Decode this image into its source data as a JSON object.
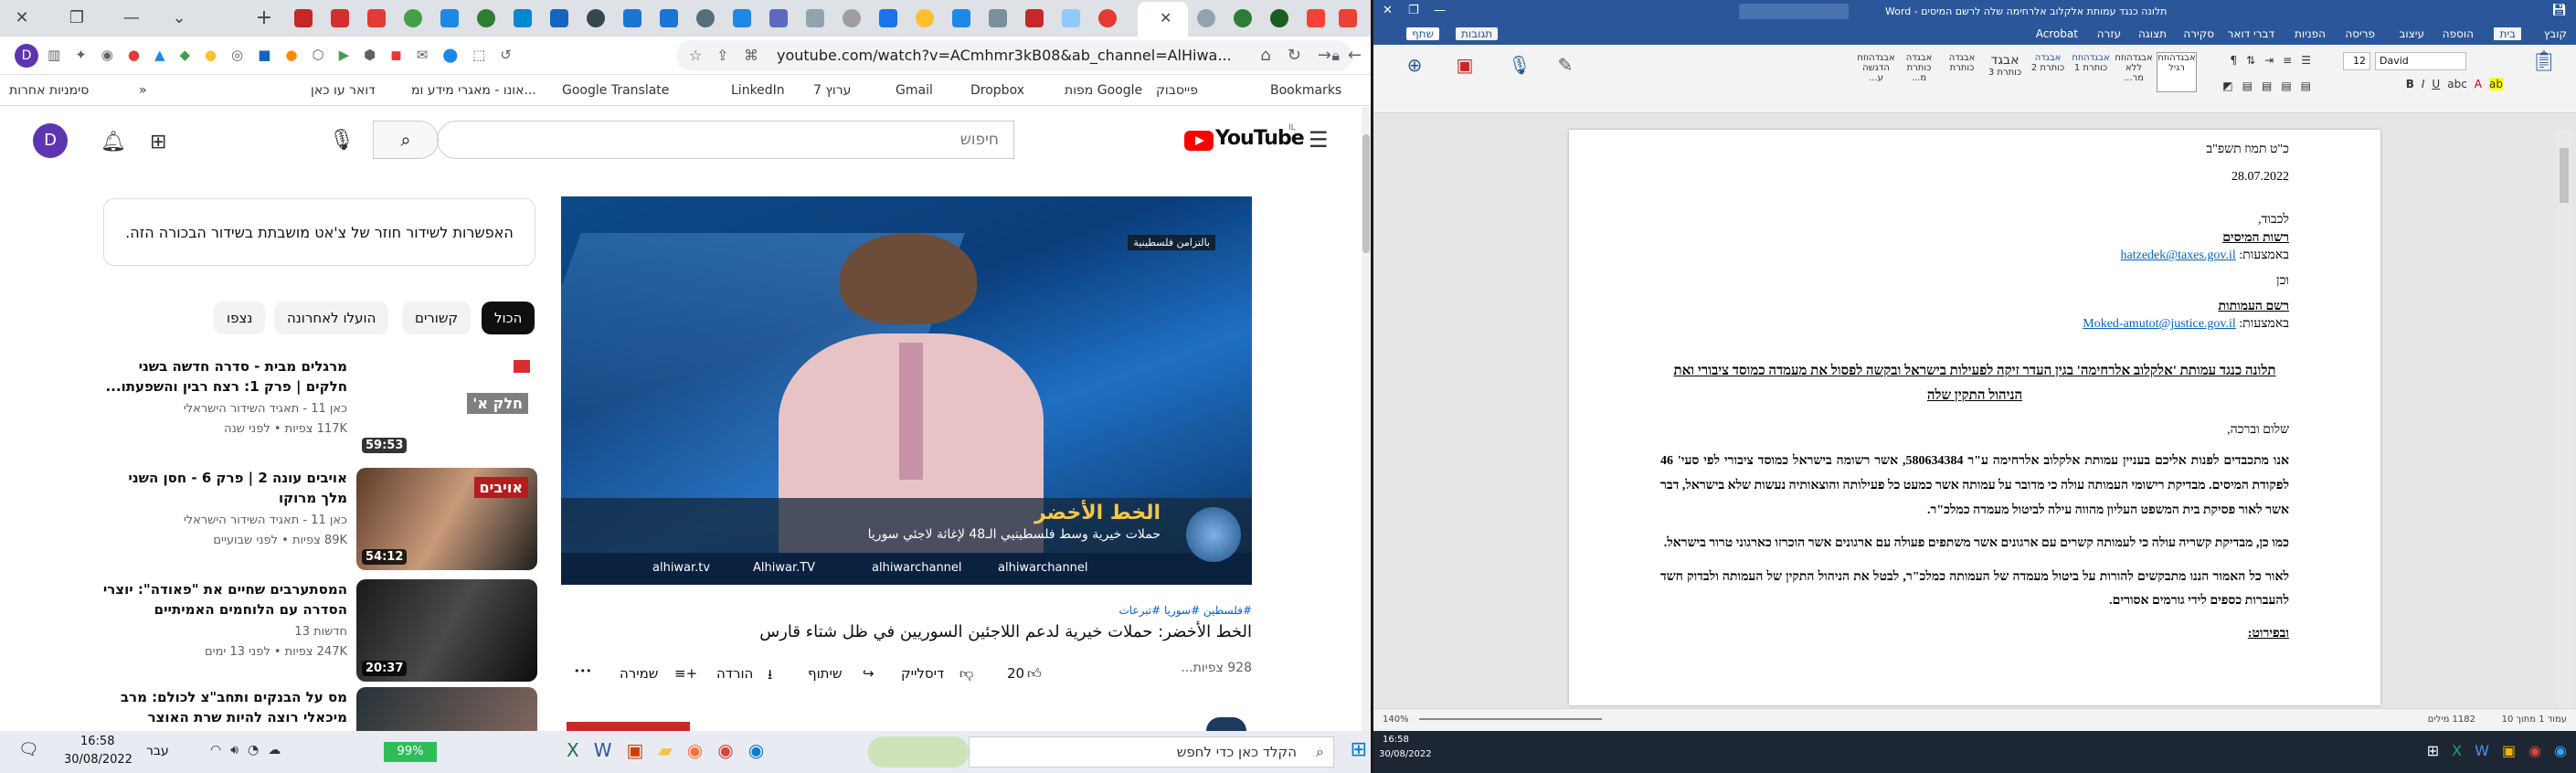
{
  "chrome": {
    "tabs_visible": [
      "Gmail",
      "YouTube"
    ],
    "new_tab": "+",
    "window": {
      "minimize": "—",
      "restore": "❐",
      "close": "✕"
    },
    "url": "youtube.com/watch?v=ACmhmr3kB08&ab_channel=AlHiwa...",
    "bookmarks": [
      "Bookmarks",
      "פייסבוק",
      "מפות Google",
      "Dropbox",
      "Gmail",
      "ערוץ 7",
      "LinkedIn",
      "Google Translate",
      "אונו - מאגרי מידע ומ...",
      "דואר עו כאן",
      "סימניות אחרות"
    ]
  },
  "youtube": {
    "logo": "YouTube",
    "logo_region": "IL",
    "search_placeholder": "חיפוש",
    "avatar_letter": "D",
    "chat_notice": "האפשרות לשידור חוזר של צ'אט מושבתת בשידור הבכורה הזה.",
    "chips": [
      "הכול",
      "קשורים",
      "הועלו לאחרונה",
      "נצפו"
    ],
    "recs": [
      {
        "title": "מרגלים מבית - סדרה חדשה בשני חלקים | פרק 1: רצח רבין והשפעתו...",
        "channel": "כאן 11 - תאגיד השידור הישראלי",
        "meta": "117K צפיות • לפני שנה",
        "duration": "59:53",
        "thumb_text": "חלק א'"
      },
      {
        "title": "אויבים עונה 2 | פרק 6 - חסן השני מלך מרוקו",
        "channel": "כאן 11 - תאגיד השידור הישראלי",
        "meta": "89K צפיות • לפני שבועיים",
        "duration": "54:12",
        "thumb_text": "אויבים"
      },
      {
        "title": "המסתערבים שחיים את \"פאודה\": יוצרי הסדרה עם הלוחמים האמיתיים",
        "channel": "חדשות 13",
        "meta": "247K צפיות • לפני 13 ימים",
        "duration": "20:37",
        "thumb_text": ""
      },
      {
        "title": "מס על הבנקים ותחב\"צ לכולם: מרב מיכאלי רוצה להיות שרת האוצר",
        "channel": "",
        "meta": "",
        "duration": "",
        "thumb_text": ""
      }
    ],
    "video": {
      "hashtags": "#فلسطين #سوريا #تبرعات",
      "title": "الخط الأخضر: حملات خيرية لدعم اللاجئين السوريين في ظل شتاء قارس",
      "views": "928 צפיות...",
      "likes": "20",
      "dislike": "דיסלייק",
      "share": "שיתוף",
      "download": "הורדה",
      "save": "שמירה",
      "more": "•••",
      "lower_third_title": "الخط الأخضر",
      "lower_third_sub": "حملات خيرية وسط فلسطينيي الـ48 لإغاثة لاجئي سوريا",
      "tag": "بالتزامن فلسطينية",
      "socials": [
        "alhiwar.tv",
        "Alhiwar.TV",
        "alhiwarchannel",
        "alhiwarchannel"
      ]
    }
  },
  "word": {
    "title": "תלונה כנגד עמותת אלקלוב אלרחימה שלה לרשם המיסים - Word",
    "tabs": [
      "קובץ",
      "בית",
      "הוספה",
      "עיצוב",
      "פריסה",
      "הפניות",
      "דברי דואר",
      "סקירה",
      "תצוגה",
      "עזרה",
      "Acrobat",
      "תגובות",
      "שתף"
    ],
    "styles": [
      "אבגדהוזח",
      "אבגדהוזח",
      "אבגדהוזח",
      "אבגדה",
      "אבגד",
      "אבגדה",
      "אבגדה",
      "אבגדהוזח"
    ],
    "style_names": [
      "רגיל",
      "ללא מר...",
      "כותרת 1",
      "כותרת 2",
      "כותרת 3",
      "כותרת",
      "כותרת מ...",
      "הדגשה ע..."
    ],
    "font_name": "David",
    "font_size": "12",
    "doc": {
      "hebdate": "כ\"ט תמוז תשפ\"ב",
      "date": "28.07.2022",
      "to": "לכבוד,",
      "addressee1": "רשות המיסים",
      "via": "באמצעות:",
      "email1": "hatzedek@taxes.gov.il",
      "and": "וכן",
      "addressee2": "רשם העמותות",
      "email2": "Moked-amutot@justice.gov.il",
      "subject": "תלונה כנגד עמותת 'אלקלוב אלרחימה' בגין העדר זיקה לפעילות בישראל ובקשה לפסול את מעמדה כמוסד ציבורי ואת הניהול התקין שלה",
      "greeting": "שלום וברכה,",
      "p1": "אנו מתכבדים לפנות אליכם בעניין עמותת אלקלוב אלרחימה ע\"ר 580634384, אשר רשומה בישראל כמוסד ציבורי לפי סעי' 46 לפקודת המיסים. מבדיקת רישומי העמותה עולה כי מדובר על עמותה אשר כמעט כל פעילותה והוצאותיה נעשות שלא בישראל, דבר אשר לאור פסיקת בית המשפט העליון מהווה עילה לביטול מעמדה כמלכ\"ר.",
      "p2": "כמו כן, מבדיקת קשריה עולה כי לעמותה קשרים עם ארגונים אשר משתפים פעולה עם ארגונים אשר הוכרזו כארגוני טרור בישראל.",
      "p3": "לאור כל האמור הננו מתבקשים להורות על ביטול מעמדה של העמותה כמלכ\"ר, לבטל את הניהול התקין של העמותה ולבדוק חשד להעברות כספים לידי גורמים אסורים.",
      "p4": "ובפירוט:"
    },
    "status_left": "עמוד 1 מתוך 10",
    "status_words": "1182 מילים",
    "zoom": "140%"
  },
  "taskbar_left": {
    "search": "הקלד כאן כדי לחפש",
    "time": "16:58",
    "date": "30/08/2022",
    "lang": "עבר",
    "battery": "99%"
  },
  "taskbar_right": {
    "time": "16:58",
    "date": "30/08/2022"
  }
}
